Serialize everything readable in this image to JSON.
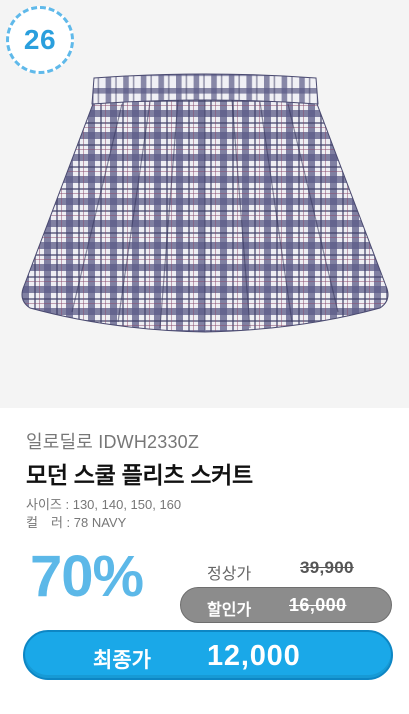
{
  "product": {
    "rank_badge": "26",
    "brand_model": "일로딜로 IDWH2330Z",
    "name": "모던 스쿨 플리츠 스커트",
    "size_line": "사이즈 : 130, 140, 150, 160",
    "color_line": "컬　러 : 78 NAVY",
    "image_alt": "plaid pleated skirt photo"
  },
  "pricing": {
    "discount": "70%",
    "regular_label": "정상가",
    "regular_price": "39,900",
    "sale_label": "할인가",
    "sale_price": "16,000",
    "final_label": "최종가",
    "final_price": "12,000"
  },
  "colors": {
    "badge_text": "#2a9fdd",
    "badge_border": "#5fb9ea",
    "discount": "#5cb8e8",
    "final_button": "#1aa8e8",
    "sale_pill": "#8c8c8c",
    "plaid_navy": "#4a4a78",
    "plaid_light": "#ececf2"
  }
}
